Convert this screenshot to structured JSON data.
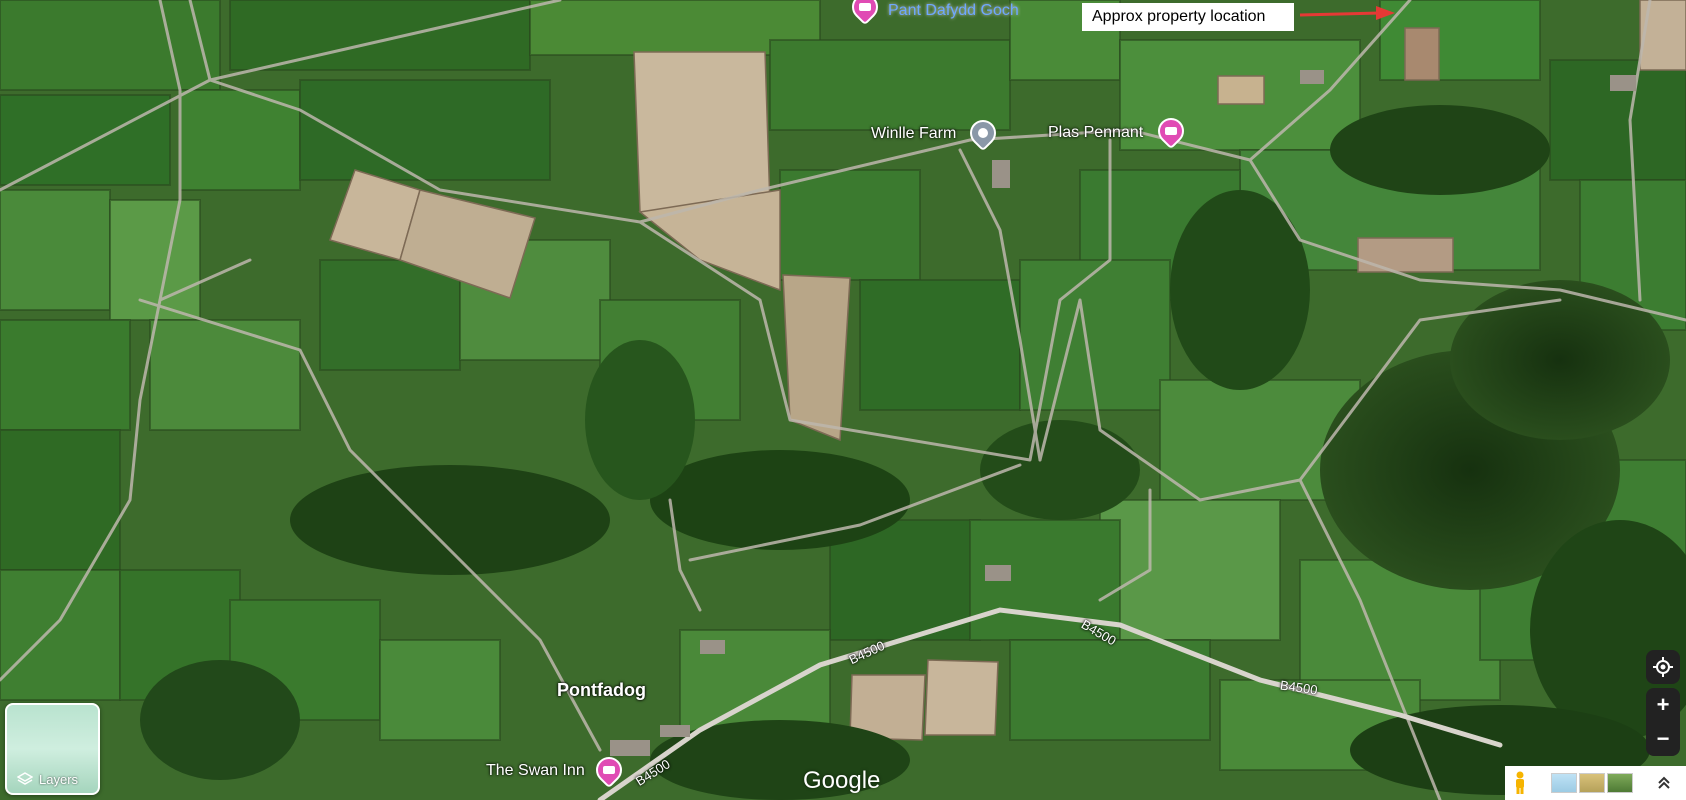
{
  "map": {
    "places": {
      "pant_dafydd_goch": "Pant Dafydd Goch",
      "winlle_farm": "Winlle Farm",
      "plas_pennant": "Plas Pennant",
      "pontfadog": "Pontfadog",
      "the_swan_inn": "The Swan Inn"
    },
    "roads": {
      "b4500_a": "B4500",
      "b4500_b": "B4500",
      "b4500_c": "B4500",
      "b4500_d": "B4500"
    },
    "callout": "Approx property location",
    "attribution": "Google"
  },
  "controls": {
    "layers_label": "Layers",
    "zoom_in": "+",
    "zoom_out": "−",
    "icons": {
      "layers": "layers-icon",
      "locate": "my-location-icon",
      "pegman": "pegman-icon",
      "expand": "expand-icon",
      "hotel": "hotel-icon",
      "place": "place-pin-icon"
    }
  },
  "colors": {
    "hotel_pin": "#e04bb4",
    "farm_pin": "#8a98a8",
    "callout_arrow": "#e53935",
    "control_bg": "#222222"
  }
}
